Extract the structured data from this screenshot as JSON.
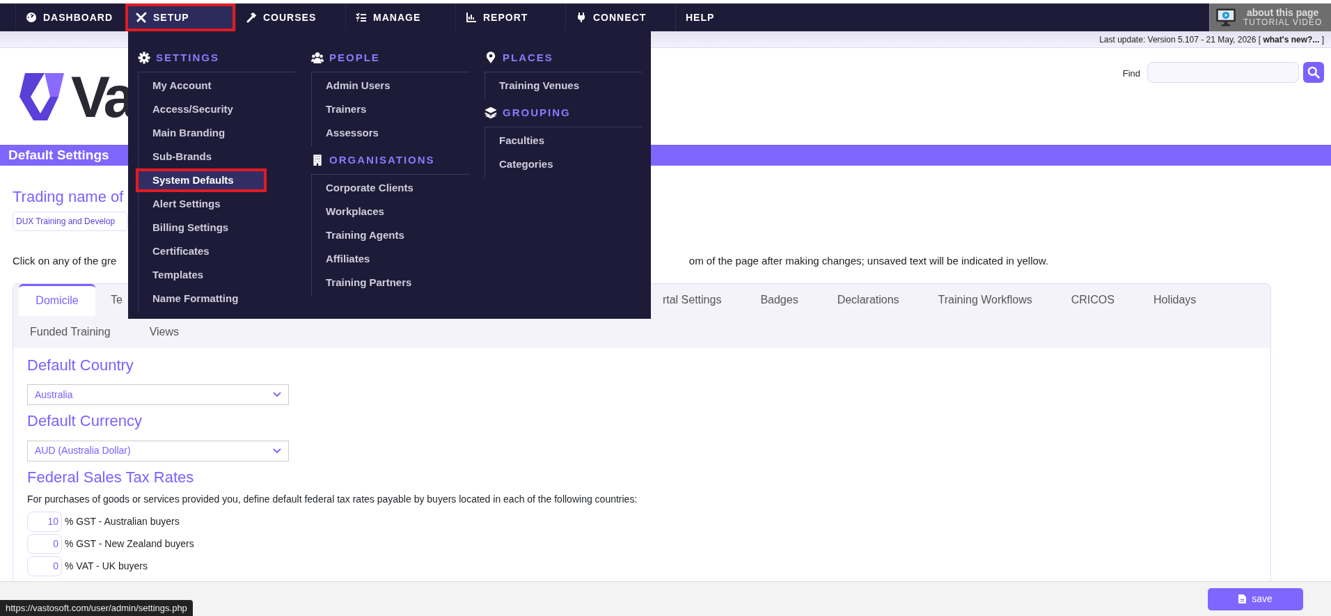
{
  "nav": {
    "items": [
      {
        "label": "DASHBOARD",
        "selected": false,
        "annotated": false
      },
      {
        "label": "SETUP",
        "selected": true,
        "annotated": true
      },
      {
        "label": "COURSES",
        "selected": false,
        "annotated": false
      },
      {
        "label": "MANAGE",
        "selected": false,
        "annotated": false
      },
      {
        "label": "REPORT",
        "selected": false,
        "annotated": false
      },
      {
        "label": "CONNECT",
        "selected": false,
        "annotated": false
      },
      {
        "label": "HELP",
        "selected": false,
        "annotated": false
      }
    ],
    "tutorial": {
      "line1": "about this page",
      "line2": "TUTORIAL VIDEO"
    }
  },
  "update_bar": {
    "text": "Last update: Version 5.107 - 21 May, 2026 [",
    "link": "what's new?...",
    "end": "]"
  },
  "header": {
    "logo_text": "Va",
    "find_label": "Find"
  },
  "page_title": "Default Settings",
  "trading_name": {
    "heading": "Trading name of",
    "value": "DUX Training and Develop"
  },
  "instructions": [
    "Click on any of the gre",
    "om of the page after making changes; unsaved text will be indicated in yellow."
  ],
  "tab_rows": [
    [
      {
        "label": "Domicile",
        "selected": true
      },
      {
        "label": "Te",
        "selected": false
      },
      {
        "label": "rtal Settings",
        "selected": false
      },
      {
        "label": "Badges",
        "selected": false
      },
      {
        "label": "Declarations",
        "selected": false
      },
      {
        "label": "Training Workflows",
        "selected": false
      },
      {
        "label": "CRICOS",
        "selected": false
      },
      {
        "label": "Holidays",
        "selected": false
      }
    ],
    [
      {
        "label": "Funded Training",
        "selected": false
      },
      {
        "label": "Views",
        "selected": false
      }
    ]
  ],
  "domicile": {
    "country": {
      "heading": "Default Country",
      "value": "Australia"
    },
    "currency": {
      "heading": "Default Currency",
      "value": "AUD (Australia Dollar)"
    },
    "tax": {
      "heading": "Federal Sales Tax Rates",
      "description": "For purchases of goods or services provided you, define default federal tax rates payable by buyers located in each of the following countries:",
      "rates": [
        {
          "value": "10",
          "label": "% GST - Australian buyers"
        },
        {
          "value": "0",
          "label": "% GST - New Zealand buyers"
        },
        {
          "value": "0",
          "label": "% VAT - UK buyers"
        }
      ]
    }
  },
  "save_button": "save",
  "status_url": "https://vastosoft.com/user/admin/settings.php",
  "menu": {
    "columns": [
      [
        {
          "heading": "SETTINGS",
          "items": [
            {
              "label": "My Account",
              "selected": false,
              "annotated": false
            },
            {
              "label": "Access/Security",
              "selected": false,
              "annotated": false
            },
            {
              "label": "Main Branding",
              "selected": false,
              "annotated": false
            },
            {
              "label": "Sub-Brands",
              "selected": false,
              "annotated": false
            },
            {
              "label": "System Defaults",
              "selected": true,
              "annotated": true
            },
            {
              "label": "Alert Settings",
              "selected": false,
              "annotated": false
            },
            {
              "label": "Billing Settings",
              "selected": false,
              "annotated": false
            },
            {
              "label": "Certificates",
              "selected": false,
              "annotated": false
            },
            {
              "label": "Templates",
              "selected": false,
              "annotated": false
            },
            {
              "label": "Name Formatting",
              "selected": false,
              "annotated": false
            }
          ]
        }
      ],
      [
        {
          "heading": "PEOPLE",
          "items": [
            {
              "label": "Admin Users",
              "selected": false,
              "annotated": false
            },
            {
              "label": "Trainers",
              "selected": false,
              "annotated": false
            },
            {
              "label": "Assessors",
              "selected": false,
              "annotated": false
            }
          ]
        },
        {
          "heading": "ORGANISATIONS",
          "items": [
            {
              "label": "Corporate Clients",
              "selected": false,
              "annotated": false
            },
            {
              "label": "Workplaces",
              "selected": false,
              "annotated": false
            },
            {
              "label": "Training Agents",
              "selected": false,
              "annotated": false
            },
            {
              "label": "Affiliates",
              "selected": false,
              "annotated": false
            },
            {
              "label": "Training Partners",
              "selected": false,
              "annotated": false
            }
          ]
        }
      ],
      [
        {
          "heading": "PLACES",
          "items": [
            {
              "label": "Training Venues",
              "selected": false,
              "annotated": false
            }
          ]
        },
        {
          "heading": "GROUPING",
          "items": [
            {
              "label": "Faculties",
              "selected": false,
              "annotated": false
            },
            {
              "label": "Categories",
              "selected": false,
              "annotated": false
            }
          ]
        }
      ]
    ]
  }
}
